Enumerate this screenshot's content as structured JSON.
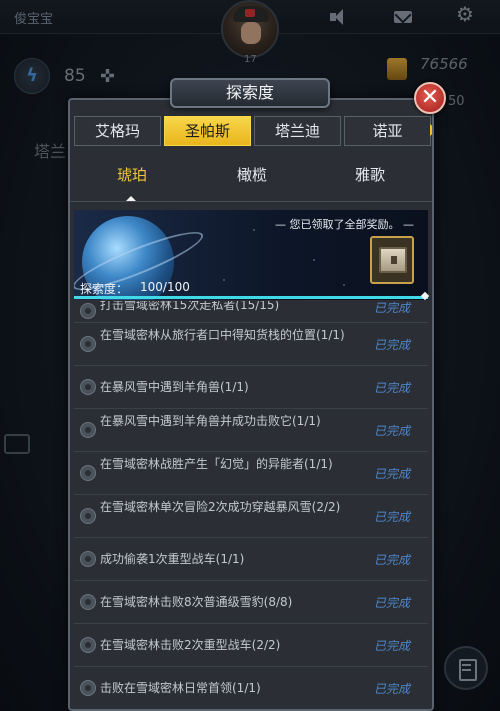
{
  "hud": {
    "player_name": "俊宝宝",
    "level": "17",
    "energy_value": "85",
    "coins": "76566",
    "gems": "50",
    "background_tab": "塔兰"
  },
  "dialog": {
    "title": "探索度",
    "close_glyph": "✕",
    "region_tabs": [
      {
        "label": "艾格玛",
        "active": false
      },
      {
        "label": "圣帕斯",
        "active": true
      },
      {
        "label": "塔兰迪",
        "active": false
      },
      {
        "label": "诺亚",
        "active": false
      }
    ],
    "sub_tabs": [
      {
        "label": "琥珀",
        "active": true
      },
      {
        "label": "橄榄",
        "active": false
      },
      {
        "label": "雅歌",
        "active": false
      }
    ],
    "banner": {
      "message": "— 您已领取了全部奖励。 —",
      "progress_label": "探索度：",
      "progress_value": "100/100",
      "progress_fraction": 1.0
    },
    "quests": [
      {
        "text": "打击雪域密林15次走私者(15/15)",
        "status": "已完成"
      },
      {
        "text": "在雪域密林从旅行者口中得知货栈的位置(1/1)",
        "status": "已完成"
      },
      {
        "text": "在暴风雪中遇到羊角兽(1/1)",
        "status": "已完成"
      },
      {
        "text": "在暴风雪中遇到羊角兽并成功击败它(1/1)",
        "status": "已完成"
      },
      {
        "text": "在雪域密林战胜产生「幻觉」的异能者(1/1)",
        "status": "已完成"
      },
      {
        "text": "在雪域密林单次冒险2次成功穿越暴风雪(2/2)",
        "status": "已完成"
      },
      {
        "text": "成功偷袭1次重型战车(1/1)",
        "status": "已完成"
      },
      {
        "text": "在雪域密林击败8次普通级雪豹(8/8)",
        "status": "已完成"
      },
      {
        "text": "在雪域密林击败2次重型战车(2/2)",
        "status": "已完成"
      },
      {
        "text": "击败在雪域密林日常首领(1/1)",
        "status": "已完成"
      }
    ]
  }
}
